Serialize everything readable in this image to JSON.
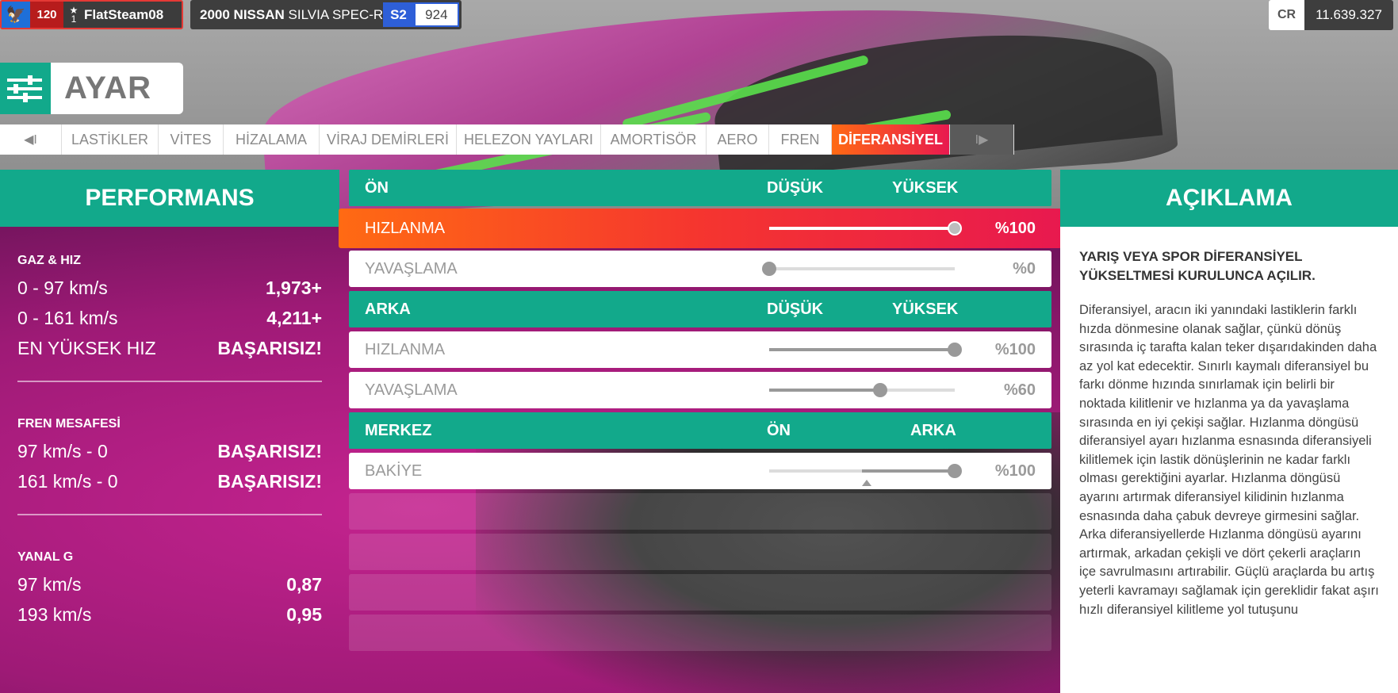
{
  "player": {
    "level": "120",
    "rank": "1",
    "name": "FlatSteam08",
    "avatar_icon": "eagle-icon"
  },
  "car": {
    "year_make": "2000 NISSAN",
    "model": "SILVIA SPEC-R",
    "class": "S2",
    "pi": "924"
  },
  "credits": {
    "label": "CR",
    "value": "11.639.327"
  },
  "title": "AYAR",
  "tabs": {
    "prev": "◀I",
    "next": "I▶",
    "items": [
      "LASTİKLER",
      "VİTES",
      "HİZALAMA",
      "VİRAJ DEMİRLERİ",
      "HELEZON YAYLARI",
      "AMORTİSÖR",
      "AERO",
      "FREN",
      "DİFERANSİYEL"
    ],
    "active": "DİFERANSİYEL"
  },
  "performance": {
    "title": "PERFORMANS",
    "sections": [
      {
        "title": "GAZ & HIZ",
        "rows": [
          {
            "label": "0 - 97 km/s",
            "value": "1,973+"
          },
          {
            "label": "0 - 161 km/s",
            "value": "4,211+"
          },
          {
            "label": "EN YÜKSEK HIZ",
            "value": "BAŞARISIZ!"
          }
        ]
      },
      {
        "title": "FREN MESAFESİ",
        "rows": [
          {
            "label": "97 km/s - 0",
            "value": "BAŞARISIZ!"
          },
          {
            "label": "161 km/s - 0",
            "value": "BAŞARISIZ!"
          }
        ]
      },
      {
        "title": "YANAL G",
        "rows": [
          {
            "label": "97 km/s",
            "value": "0,87"
          },
          {
            "label": "193 km/s",
            "value": "0,95"
          }
        ]
      }
    ]
  },
  "tuning": {
    "front": {
      "label": "ÖN",
      "low": "DÜŞÜK",
      "high": "YÜKSEK",
      "rows": [
        {
          "label": "HIZLANMA",
          "value": "%100",
          "level": 1.0
        },
        {
          "label": "YAVAŞLAMA",
          "value": "%0",
          "level": 0.0
        }
      ]
    },
    "rear": {
      "label": "ARKA",
      "low": "DÜŞÜK",
      "high": "YÜKSEK",
      "rows": [
        {
          "label": "HIZLANMA",
          "value": "%100",
          "level": 1.0
        },
        {
          "label": "YAVAŞLAMA",
          "value": "%60",
          "level": 0.6
        }
      ]
    },
    "center": {
      "label": "MERKEZ",
      "low": "ÖN",
      "high": "ARKA",
      "rows": [
        {
          "label": "BAKİYE",
          "value": "%100",
          "level": 1.0
        }
      ]
    }
  },
  "description": {
    "title": "AÇIKLAMA",
    "subtitle": "YARIŞ VEYA SPOR DİFERANSİYEL YÜKSELTMESİ KURULUNCA AÇILIR.",
    "body": "Diferansiyel, aracın iki yanındaki lastiklerin farklı hızda dönmesine olanak sağlar, çünkü dönüş sırasında iç tarafta kalan teker dışarıdakinden daha az yol kat edecektir. Sınırlı kaymalı diferansiyel bu farkı dönme hızında sınırlamak için belirli bir noktada kilitlenir ve hızlanma ya da yavaşlama sırasında en iyi çekişi sağlar. Hızlanma döngüsü diferansiyel ayarı hızlanma esnasında diferansiyeli kilitlemek için lastik dönüşlerinin ne kadar farklı olması gerektiğini ayarlar. Hızlanma döngüsü ayarını artırmak diferansiyel kilidinin hızlanma esnasında daha çabuk devreye girmesini sağlar. Arka diferansiyellerde Hızlanma döngüsü ayarını artırmak, arkadan çekişli ve dört çekerli araçların içe savrulmasını artırabilir. Güçlü araçlarda bu artış yeterli kavramayı sağlamak için gereklidir fakat aşırı hızlı diferansiyel kilitleme yol tutuşunu"
  },
  "colors": {
    "teal": "#12a98b",
    "accent_start": "#ff6a13",
    "accent_end": "#e8194f",
    "class_blue": "#2e5fd8",
    "player_red": "#b71c1c"
  }
}
